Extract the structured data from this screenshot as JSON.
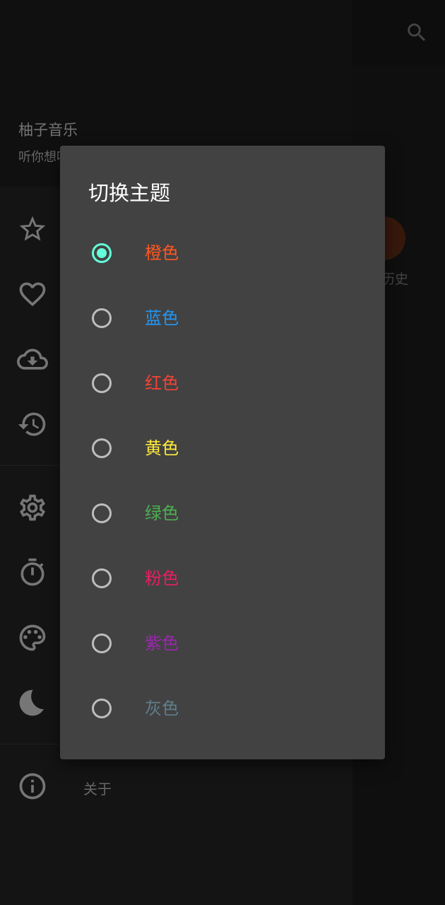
{
  "app": {
    "name": "柚子音乐",
    "slogan": "听你想听"
  },
  "main": {
    "history_label": "历史",
    "colors": {
      "history_accent": "#4a2210"
    }
  },
  "drawer": {
    "icons": [
      "star-icon",
      "heart-icon",
      "cloud-download-icon",
      "history-icon",
      "gear-icon",
      "timer-icon",
      "palette-icon",
      "moon-icon",
      "info-icon"
    ],
    "about_label": "关于"
  },
  "dialog": {
    "title": "切换主题",
    "options": [
      {
        "label": "橙色",
        "color": "#ff5722",
        "selected": true
      },
      {
        "label": "蓝色",
        "color": "#2196f3",
        "selected": false
      },
      {
        "label": "红色",
        "color": "#f44336",
        "selected": false
      },
      {
        "label": "黄色",
        "color": "#ffeb3b",
        "selected": false
      },
      {
        "label": "绿色",
        "color": "#4caf50",
        "selected": false
      },
      {
        "label": "粉色",
        "color": "#e91e63",
        "selected": false
      },
      {
        "label": "紫色",
        "color": "#9c27b0",
        "selected": false
      },
      {
        "label": "灰色",
        "color": "#607d8b",
        "selected": false
      }
    ],
    "accent": "#64ffda"
  }
}
